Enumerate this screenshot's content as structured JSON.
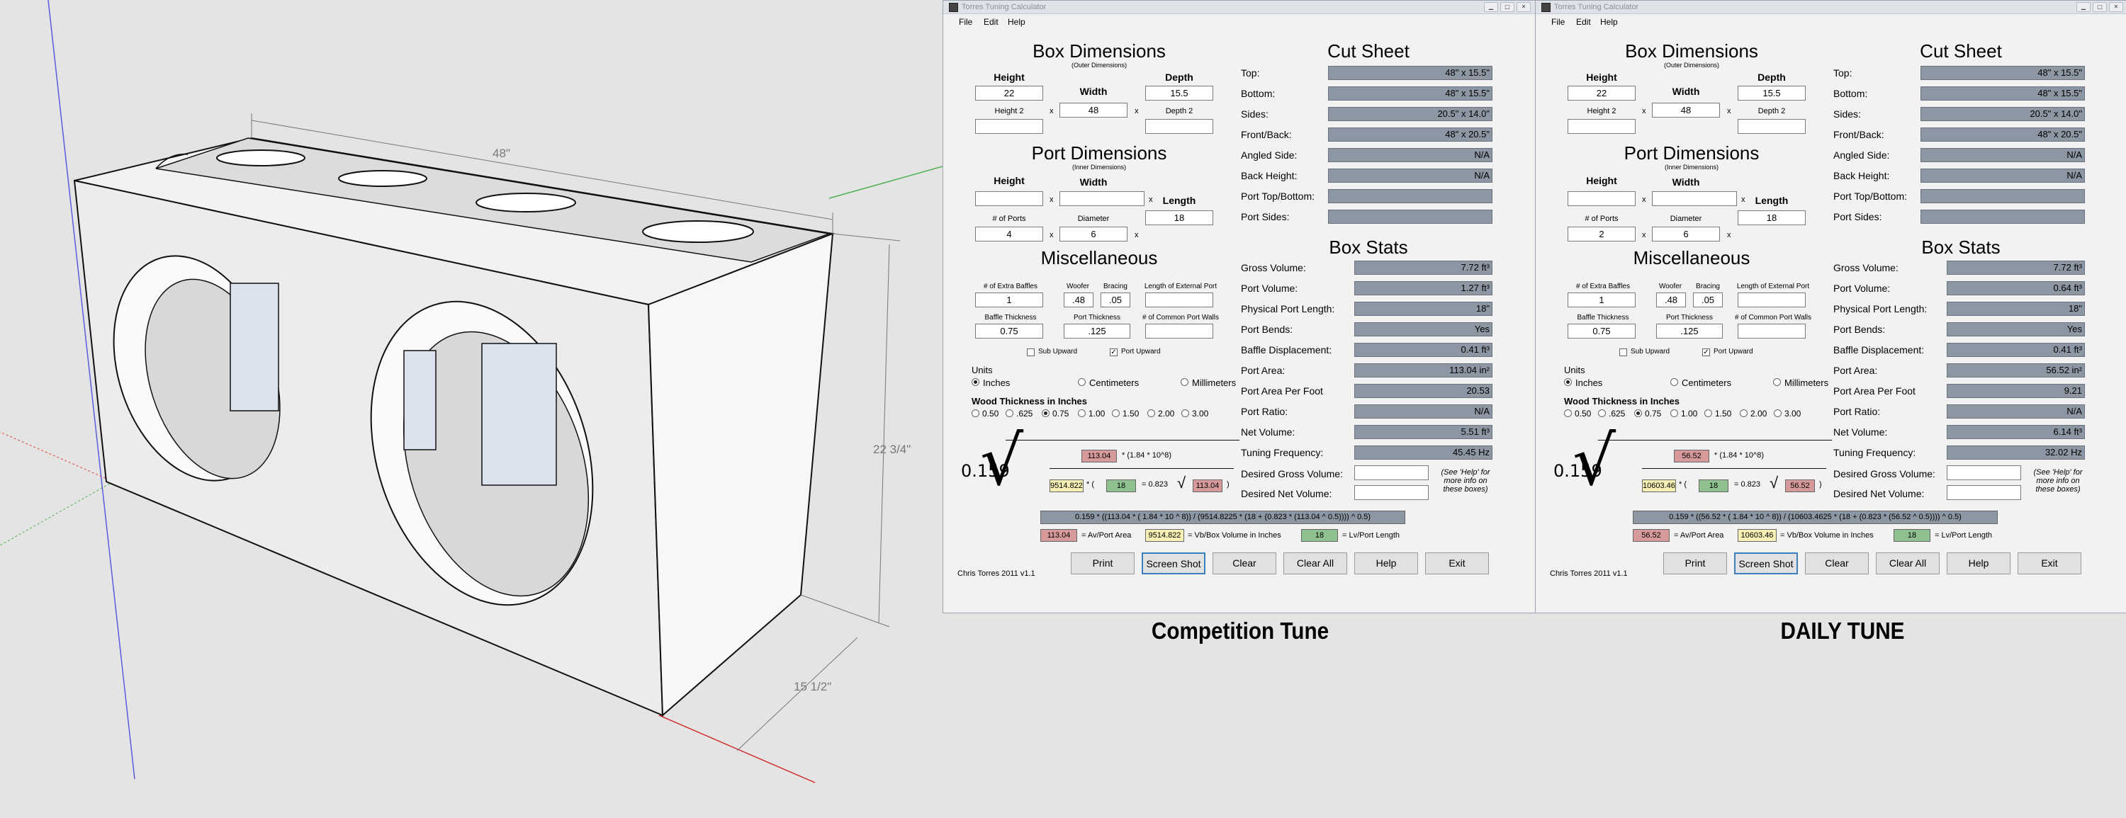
{
  "sketch": {
    "dim_width": "48\"",
    "dim_height": "22 3/4\"",
    "dim_depth": "15 1/2\""
  },
  "windows": [
    {
      "title": "Torres Tuning Calculator",
      "menu": [
        "File",
        "Edit",
        "Help"
      ],
      "box_dimensions": {
        "heading": "Box Dimensions",
        "subheading": "(Outer Dimensions)",
        "height_label": "Height",
        "width_label": "Width",
        "depth_label": "Depth",
        "height": "22",
        "width": "48",
        "depth": "15.5",
        "height2_label": "Height 2",
        "depth2_label": "Depth 2",
        "height2": "",
        "depth2": ""
      },
      "port_dimensions": {
        "heading": "Port Dimensions",
        "subheading": "(Inner Dimensions)",
        "height_label": "Height",
        "width_label": "Width",
        "length_label": "Length",
        "height": "",
        "width": "",
        "length": "18",
        "ports_label": "# of Ports",
        "diameter_label": "Diameter",
        "ports": "4",
        "diameter": "6"
      },
      "misc": {
        "heading": "Miscellaneous",
        "extra_baffles_label": "# of Extra Baffles",
        "woofer_label": "Woofer",
        "bracing_label": "Bracing",
        "ext_port_label": "Length of External Port",
        "extra_baffles": "1",
        "woofer": ".48",
        "bracing": ".05",
        "ext_port": "",
        "baffle_thickness_label": "Baffle Thickness",
        "port_thickness_label": "Port Thickness",
        "common_walls_label": "# of Common Port Walls",
        "baffle_thickness": "0.75",
        "port_thickness": ".125",
        "common_walls": "",
        "sub_upward_label": "Sub Upward",
        "port_upward_label": "Port Upward",
        "sub_upward": "",
        "port_upward": "✓"
      },
      "units": {
        "heading": "Units",
        "options": [
          "Inches",
          "Centimeters",
          "Millimeters"
        ]
      },
      "wood": {
        "heading": "Wood Thickness in Inches",
        "options": [
          "0.50",
          ".625",
          "0.75",
          "1.00",
          "1.50",
          "2.00",
          "3.00"
        ]
      },
      "cut_sheet": {
        "heading": "Cut Sheet",
        "rows": [
          {
            "label": "Top:",
            "value": "48\" x 15.5\""
          },
          {
            "label": "Bottom:",
            "value": "48\" x 15.5\""
          },
          {
            "label": "Sides:",
            "value": "20.5\" x 14.0\""
          },
          {
            "label": "Front/Back:",
            "value": "48\" x 20.5\""
          },
          {
            "label": "Angled Side:",
            "value": "N/A"
          },
          {
            "label": "Back Height:",
            "value": "N/A"
          },
          {
            "label": "Port Top/Bottom:",
            "value": ""
          },
          {
            "label": "Port Sides:",
            "value": ""
          }
        ]
      },
      "box_stats": {
        "heading": "Box Stats",
        "rows": [
          {
            "label": "Gross Volume:",
            "value": "7.72 ft³"
          },
          {
            "label": "Port Volume:",
            "value": "1.27 ft³"
          },
          {
            "label": "Physical Port Length:",
            "value": "18\""
          },
          {
            "label": "Port Bends:",
            "value": "Yes"
          },
          {
            "label": "Baffle Displacement:",
            "value": "0.41 ft³"
          },
          {
            "label": "Port Area:",
            "value": "113.04 in²"
          },
          {
            "label": "Port Area Per Foot",
            "value": "20.53"
          },
          {
            "label": "Port Ratio:",
            "value": "N/A"
          },
          {
            "label": "Net Volume:",
            "value": "5.51 ft³"
          },
          {
            "label": "Tuning Frequency:",
            "value": "45.45 Hz"
          }
        ],
        "desired_gross_label": "Desired Gross Volume:",
        "desired_net_label": "Desired Net Volume:",
        "desired_gross": "",
        "desired_net": "",
        "help_note": "(See 'Help' for more info on these boxes)"
      },
      "formula": {
        "coef": "0.159",
        "av_top": "113.04",
        "factor": "* (1.84 * 10^8)",
        "vb": "9514.822",
        "lv": "18",
        "k": "= 0.823",
        "av_inner": "113.04",
        "full": "0.159 * ((113.04 * ( 1.84 * 10 ^ 8)) / (9514.8225 * (18 + (0.823 * (113.04 ^ 0.5)))) ^ 0.5)",
        "legend_av": "113.04",
        "legend_av_label": "= Av/Port Area",
        "legend_vb": "9514.822",
        "legend_vb_label": "= Vb/Box Volume in Inches",
        "legend_lv": "18",
        "legend_lv_label": "= Lv/Port Length"
      },
      "buttons": [
        "Print",
        "Screen Shot",
        "Clear",
        "Clear All",
        "Help",
        "Exit"
      ],
      "credit": "Chris Torres 2011 v1.1",
      "caption": "Competition Tune"
    },
    {
      "title": "Torres Tuning Calculator",
      "menu": [
        "File",
        "Edit",
        "Help"
      ],
      "box_dimensions": {
        "heading": "Box Dimensions",
        "subheading": "(Outer Dimensions)",
        "height_label": "Height",
        "width_label": "Width",
        "depth_label": "Depth",
        "height": "22",
        "width": "48",
        "depth": "15.5",
        "height2_label": "Height 2",
        "depth2_label": "Depth 2",
        "height2": "",
        "depth2": ""
      },
      "port_dimensions": {
        "heading": "Port Dimensions",
        "subheading": "(Inner Dimensions)",
        "height_label": "Height",
        "width_label": "Width",
        "length_label": "Length",
        "height": "",
        "width": "",
        "length": "18",
        "ports_label": "# of Ports",
        "diameter_label": "Diameter",
        "ports": "2",
        "diameter": "6"
      },
      "misc": {
        "heading": "Miscellaneous",
        "extra_baffles_label": "# of Extra Baffles",
        "woofer_label": "Woofer",
        "bracing_label": "Bracing",
        "ext_port_label": "Length of External Port",
        "extra_baffles": "1",
        "woofer": ".48",
        "bracing": ".05",
        "ext_port": "",
        "baffle_thickness_label": "Baffle Thickness",
        "port_thickness_label": "Port Thickness",
        "common_walls_label": "# of Common Port Walls",
        "baffle_thickness": "0.75",
        "port_thickness": ".125",
        "common_walls": "",
        "sub_upward_label": "Sub Upward",
        "port_upward_label": "Port Upward",
        "sub_upward": "",
        "port_upward": "✓"
      },
      "units": {
        "heading": "Units",
        "options": [
          "Inches",
          "Centimeters",
          "Millimeters"
        ]
      },
      "wood": {
        "heading": "Wood Thickness in Inches",
        "options": [
          "0.50",
          ".625",
          "0.75",
          "1.00",
          "1.50",
          "2.00",
          "3.00"
        ]
      },
      "cut_sheet": {
        "heading": "Cut Sheet",
        "rows": [
          {
            "label": "Top:",
            "value": "48\" x 15.5\""
          },
          {
            "label": "Bottom:",
            "value": "48\" x 15.5\""
          },
          {
            "label": "Sides:",
            "value": "20.5\" x 14.0\""
          },
          {
            "label": "Front/Back:",
            "value": "48\" x 20.5\""
          },
          {
            "label": "Angled Side:",
            "value": "N/A"
          },
          {
            "label": "Back Height:",
            "value": "N/A"
          },
          {
            "label": "Port Top/Bottom:",
            "value": ""
          },
          {
            "label": "Port Sides:",
            "value": ""
          }
        ]
      },
      "box_stats": {
        "heading": "Box Stats",
        "rows": [
          {
            "label": "Gross Volume:",
            "value": "7.72 ft³"
          },
          {
            "label": "Port Volume:",
            "value": "0.64 ft³"
          },
          {
            "label": "Physical Port Length:",
            "value": "18\""
          },
          {
            "label": "Port Bends:",
            "value": "Yes"
          },
          {
            "label": "Baffle Displacement:",
            "value": "0.41 ft³"
          },
          {
            "label": "Port Area:",
            "value": "56.52 in²"
          },
          {
            "label": "Port Area Per Foot",
            "value": "9.21"
          },
          {
            "label": "Port Ratio:",
            "value": "N/A"
          },
          {
            "label": "Net Volume:",
            "value": "6.14 ft³"
          },
          {
            "label": "Tuning Frequency:",
            "value": "32.02 Hz"
          }
        ],
        "desired_gross_label": "Desired Gross Volume:",
        "desired_net_label": "Desired Net Volume:",
        "desired_gross": "",
        "desired_net": "",
        "help_note": "(See 'Help' for more info on these boxes)"
      },
      "formula": {
        "coef": "0.159",
        "av_top": "56.52",
        "factor": "* (1.84 * 10^8)",
        "vb": "10603.46",
        "lv": "18",
        "k": "= 0.823",
        "av_inner": "56.52",
        "full": "0.159 * ((56.52 * ( 1.84 * 10 ^ 8)) / (10603.4625 * (18 + (0.823 * (56.52 ^ 0.5)))) ^ 0.5)",
        "legend_av": "56.52",
        "legend_av_label": "= Av/Port Area",
        "legend_vb": "10603.46",
        "legend_vb_label": "= Vb/Box Volume in Inches",
        "legend_lv": "18",
        "legend_lv_label": "= Lv/Port Length"
      },
      "buttons": [
        "Print",
        "Screen Shot",
        "Clear",
        "Clear All",
        "Help",
        "Exit"
      ],
      "credit": "Chris Torres 2011 v1.1",
      "caption": "DAILY TUNE"
    }
  ]
}
